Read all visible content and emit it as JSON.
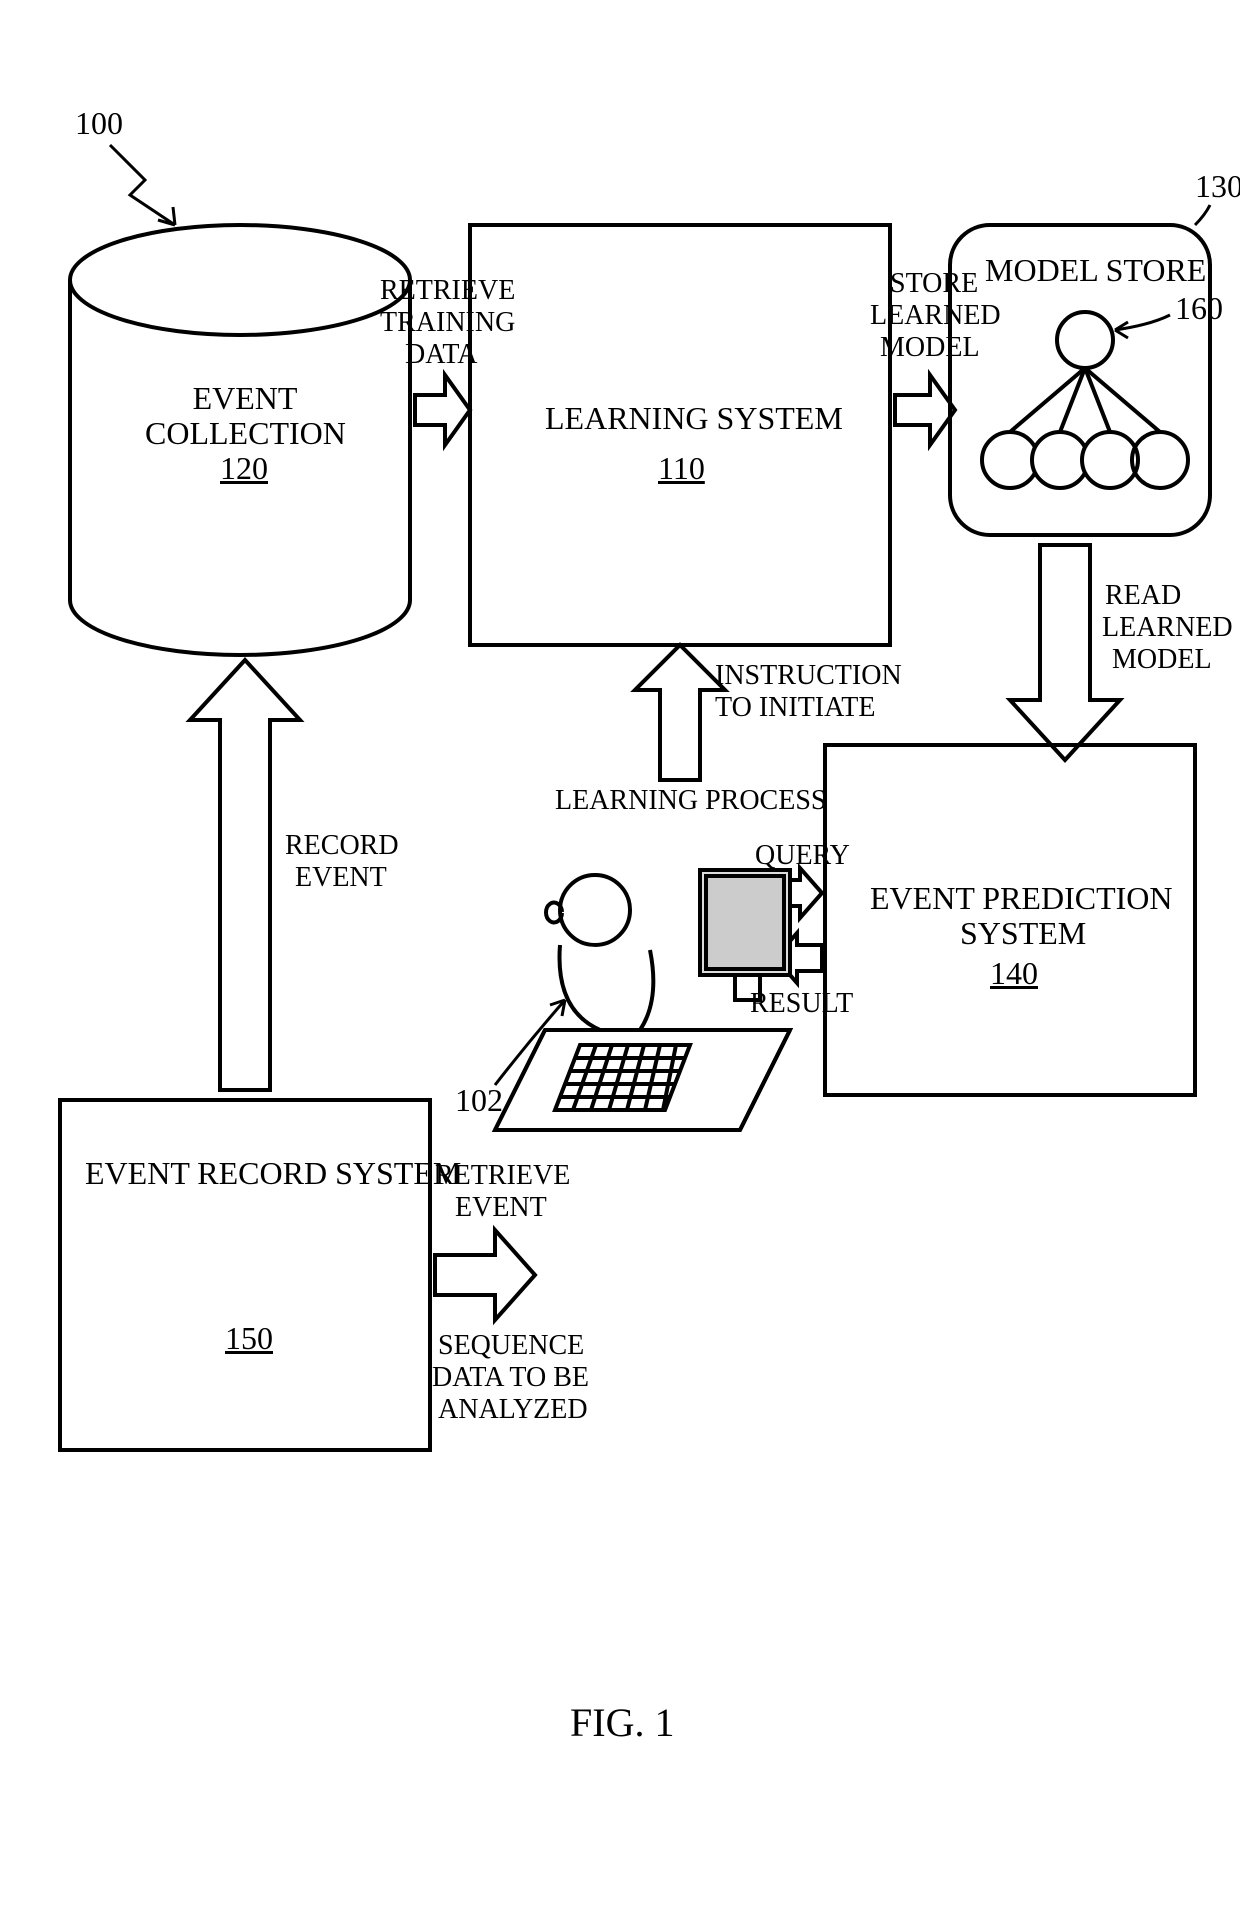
{
  "figure_label": "FIG. 1",
  "callouts": {
    "overall": "100",
    "user": "102",
    "learning_system": "110",
    "event_collection": "120",
    "model_store": "130",
    "event_prediction_system": "140",
    "event_record_system": "150",
    "model_network": "160"
  },
  "boxes": {
    "event_collection": {
      "title_l1": "EVENT",
      "title_l2": "COLLECTION"
    },
    "learning_system": {
      "title": "LEARNING SYSTEM"
    },
    "model_store": {
      "title": "MODEL STORE"
    },
    "event_prediction_system": {
      "title_l1": "EVENT PREDICTION",
      "title_l2": "SYSTEM"
    },
    "event_record_system": {
      "title": "EVENT RECORD SYSTEM"
    }
  },
  "arrows": {
    "retrieve_training": {
      "l1": "RETRIEVE",
      "l2": "TRAINING",
      "l3": "DATA"
    },
    "store_learned_model": {
      "l1": "STORE",
      "l2": "LEARNED",
      "l3": "MODEL"
    },
    "read_learned_model": {
      "l1": "READ",
      "l2": "LEARNED",
      "l3": "MODEL"
    },
    "record_event": {
      "l1": "RECORD",
      "l2": "EVENT"
    },
    "instruction": {
      "l1": "INSTRUCTION",
      "l2": "TO INITIATE",
      "l3": "LEARNING PROCESS"
    },
    "retrieve_event_seq": {
      "l1": "RETRIEVE",
      "l2": "EVENT",
      "l3": "SEQUENCE",
      "l4": "DATA TO BE",
      "l5": "ANALYZED"
    },
    "query": "QUERY",
    "result": "RESULT"
  }
}
